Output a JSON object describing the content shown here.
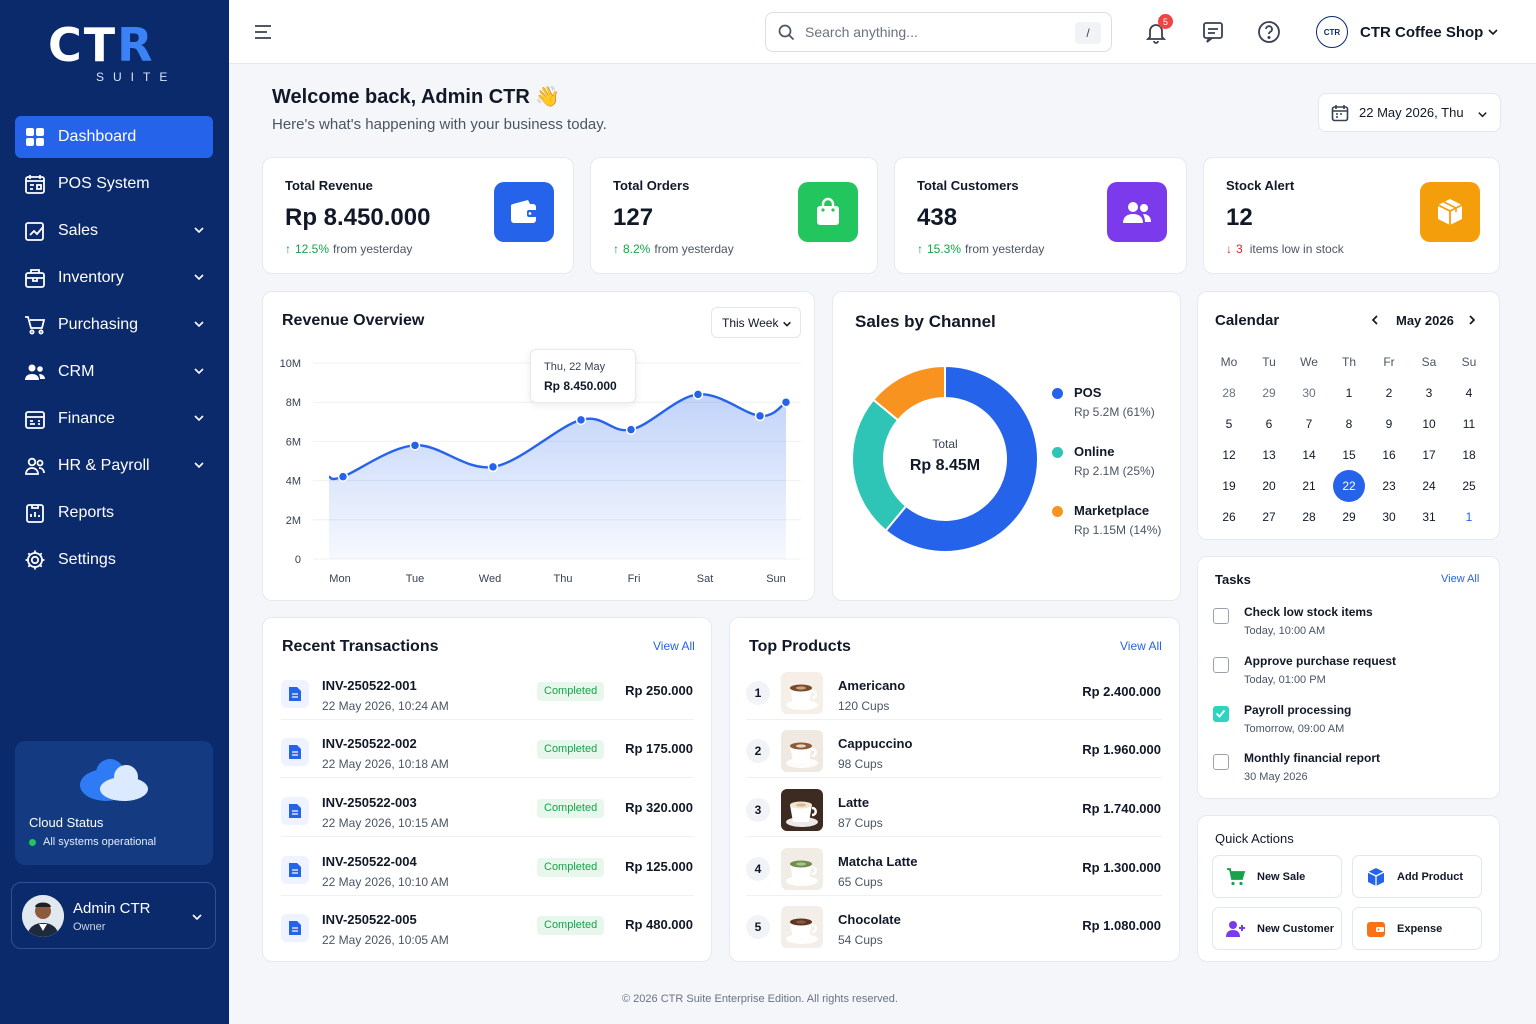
{
  "brand": {
    "logo_main_a": "CT",
    "logo_main_b": "R",
    "logo_sub": "SUITE"
  },
  "sidebar": {
    "items": [
      {
        "label": "Dashboard",
        "icon": "dashboard-icon",
        "active": true
      },
      {
        "label": "POS System",
        "icon": "pos-icon"
      },
      {
        "label": "Sales",
        "icon": "sales-icon",
        "expandable": true
      },
      {
        "label": "Inventory",
        "icon": "inventory-icon",
        "expandable": true
      },
      {
        "label": "Purchasing",
        "icon": "cart-icon",
        "expandable": true
      },
      {
        "label": "CRM",
        "icon": "users-icon",
        "expandable": true
      },
      {
        "label": "Finance",
        "icon": "finance-icon",
        "expandable": true
      },
      {
        "label": "HR & Payroll",
        "icon": "hr-icon",
        "expandable": true
      },
      {
        "label": "Reports",
        "icon": "reports-icon"
      },
      {
        "label": "Settings",
        "icon": "gear-icon"
      }
    ],
    "cloud": {
      "title": "Cloud Status",
      "status": "All systems operational"
    },
    "user": {
      "name": "Admin CTR",
      "role": "Owner"
    }
  },
  "topbar": {
    "search_placeholder": "Search anything...",
    "search_shortcut": "/",
    "notification_count": "5",
    "shop_logo_text": "CTR",
    "shop_name": "CTR Coffee Shop"
  },
  "welcome": {
    "title": "Welcome back, Admin CTR 👋",
    "subtitle": "Here's what's happening with your business today.",
    "date": "22 May 2026, Thu"
  },
  "kpis": [
    {
      "label": "Total Revenue",
      "value": "Rp 8.450.000",
      "change": "12.5%",
      "change_text": "from yesterday",
      "direction": "up",
      "color": "#2563eb",
      "icon": "wallet-icon"
    },
    {
      "label": "Total Orders",
      "value": "127",
      "change": "8.2%",
      "change_text": "from yesterday",
      "direction": "up",
      "color": "#22c55e",
      "icon": "shopping-bag-icon"
    },
    {
      "label": "Total Customers",
      "value": "438",
      "change": "15.3%",
      "change_text": "from yesterday",
      "direction": "up",
      "color": "#7c3aed",
      "icon": "users-icon"
    },
    {
      "label": "Stock Alert",
      "value": "12",
      "change": "3",
      "change_text": "items low in stock",
      "direction": "down",
      "color": "#f59e0b",
      "icon": "box-icon"
    }
  ],
  "revenue": {
    "title": "Revenue Overview",
    "range": "This Week",
    "tooltip_date": "Thu, 22 May",
    "tooltip_value": "Rp 8.450.000"
  },
  "chart_data": [
    {
      "type": "area",
      "title": "Revenue Overview",
      "categories": [
        "Mon",
        "Tue",
        "Wed",
        "Thu",
        "Fri",
        "Sat",
        "Sun"
      ],
      "x": [
        "Mon",
        "Mon-Tue",
        "Tue",
        "Wed",
        "Thu",
        "Fri",
        "Sat",
        "Sat-Sun",
        "Sun"
      ],
      "values": [
        4.2,
        5.8,
        4.7,
        7.1,
        6.6,
        8.4,
        7.3,
        8.0
      ],
      "yticks": [
        "0",
        "2M",
        "4M",
        "6M",
        "8M",
        "10M"
      ],
      "ylim": [
        0,
        10
      ],
      "color": "#2563eb",
      "grid": true
    },
    {
      "type": "pie",
      "title": "Sales by Channel",
      "center_label": "Total",
      "center_value": "Rp 8.45M",
      "slices": [
        {
          "name": "POS",
          "value": 61,
          "label": "Rp 5.2M (61%)",
          "color": "#2563eb"
        },
        {
          "name": "Online",
          "value": 25,
          "label": "Rp 2.1M (25%)",
          "color": "#2ec4b6"
        },
        {
          "name": "Marketplace",
          "value": 14,
          "label": "Rp 1.15M (14%)",
          "color": "#f7931e"
        }
      ]
    }
  ],
  "calendar": {
    "title": "Calendar",
    "month": "May 2026",
    "weekdays": [
      "Mo",
      "Tu",
      "We",
      "Th",
      "Fr",
      "Sa",
      "Su"
    ],
    "weeks": [
      [
        "28",
        "29",
        "30",
        "1",
        "2",
        "3",
        "4"
      ],
      [
        "5",
        "6",
        "7",
        "8",
        "9",
        "10",
        "11"
      ],
      [
        "12",
        "13",
        "14",
        "15",
        "16",
        "17",
        "18"
      ],
      [
        "19",
        "20",
        "21",
        "22",
        "23",
        "24",
        "25"
      ],
      [
        "26",
        "27",
        "28",
        "29",
        "30",
        "31",
        "1"
      ]
    ],
    "selected": "22"
  },
  "tasks": {
    "title": "Tasks",
    "view_all": "View All",
    "items": [
      {
        "title": "Check low stock items",
        "time": "Today, 10:00 AM",
        "done": false
      },
      {
        "title": "Approve purchase request",
        "time": "Today, 01:00 PM",
        "done": false
      },
      {
        "title": "Payroll processing",
        "time": "Tomorrow, 09:00 AM",
        "done": true
      },
      {
        "title": "Monthly financial report",
        "time": "30 May 2026",
        "done": false
      }
    ]
  },
  "quick_actions": {
    "title": "Quick Actions",
    "items": [
      {
        "label": "New Sale",
        "icon": "cart-icon",
        "color": "#16a34a"
      },
      {
        "label": "Add Product",
        "icon": "box-icon",
        "color": "#2563eb"
      },
      {
        "label": "New Customer",
        "icon": "add-user-icon",
        "color": "#7c3aed"
      },
      {
        "label": "Expense",
        "icon": "wallet-icon",
        "color": "#f97316"
      }
    ]
  },
  "transactions": {
    "title": "Recent Transactions",
    "view_all": "View All",
    "rows": [
      {
        "id": "INV-250522-001",
        "date": "22 May 2026, 10:24 AM",
        "status": "Completed",
        "amount": "Rp 250.000"
      },
      {
        "id": "INV-250522-002",
        "date": "22 May 2026, 10:18 AM",
        "status": "Completed",
        "amount": "Rp 175.000"
      },
      {
        "id": "INV-250522-003",
        "date": "22 May 2026, 10:15 AM",
        "status": "Completed",
        "amount": "Rp 320.000"
      },
      {
        "id": "INV-250522-004",
        "date": "22 May 2026, 10:10 AM",
        "status": "Completed",
        "amount": "Rp 125.000"
      },
      {
        "id": "INV-250522-005",
        "date": "22 May 2026, 10:05 AM",
        "status": "Completed",
        "amount": "Rp 480.000"
      }
    ]
  },
  "products": {
    "title": "Top Products",
    "view_all": "View All",
    "rows": [
      {
        "rank": "1",
        "name": "Americano",
        "qty": "120 Cups",
        "amount": "Rp 2.400.000"
      },
      {
        "rank": "2",
        "name": "Cappuccino",
        "qty": "98 Cups",
        "amount": "Rp 1.960.000"
      },
      {
        "rank": "3",
        "name": "Latte",
        "qty": "87 Cups",
        "amount": "Rp 1.740.000"
      },
      {
        "rank": "4",
        "name": "Matcha Latte",
        "qty": "65 Cups",
        "amount": "Rp 1.300.000"
      },
      {
        "rank": "5",
        "name": "Chocolate",
        "qty": "54 Cups",
        "amount": "Rp 1.080.000"
      }
    ]
  },
  "footer": "© 2026 CTR Suite Enterprise Edition. All rights reserved."
}
